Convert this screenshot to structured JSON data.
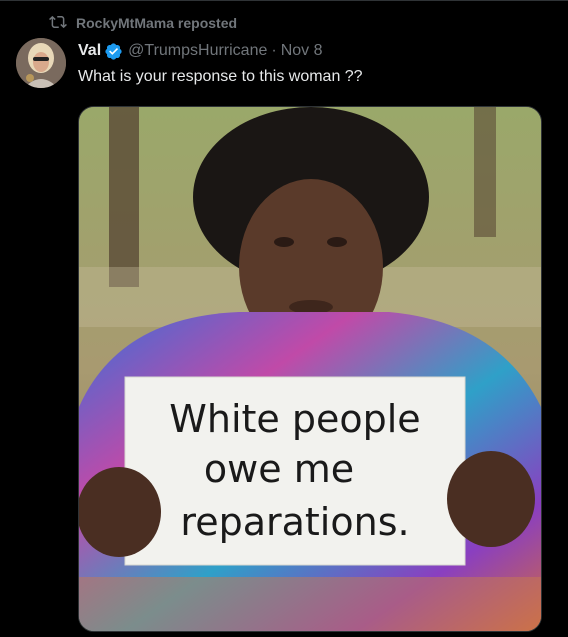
{
  "social_context": {
    "label": "RockyMtMama reposted",
    "icon": "repost-icon"
  },
  "author": {
    "name": "Val",
    "verified": true,
    "handle": "@TrumpsHurricane",
    "separator": "·",
    "date": "Nov 8"
  },
  "post": {
    "text": "What is your response to this woman ??"
  },
  "media": {
    "sign_lines": [
      "White people",
      "owe me",
      "reparations."
    ]
  },
  "colors": {
    "background": "#000000",
    "secondary_text": "#71767b",
    "verified_blue": "#1d9bf0"
  }
}
